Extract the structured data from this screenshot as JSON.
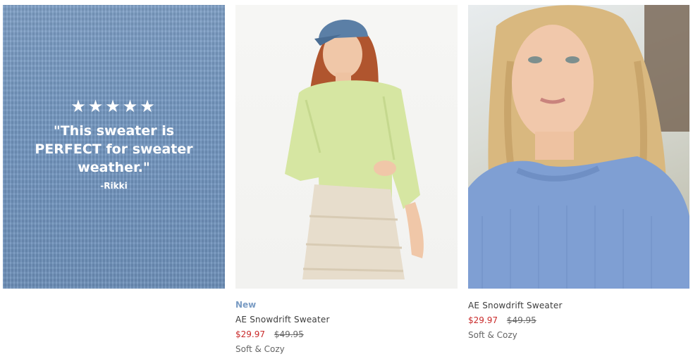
{
  "review": {
    "stars": "★★★★★",
    "quote": "\"This sweater is PERFECT for sweater weather.\"",
    "author": "-Rikki"
  },
  "products": [
    {
      "badge": "New",
      "name": "AE Snowdrift Sweater",
      "sale_price": "$29.97",
      "original_price": "$49.95",
      "tagline": "Soft & Cozy",
      "sweater_color": "#d6e6a2"
    },
    {
      "name": "AE Snowdrift Sweater",
      "sale_price": "$29.97",
      "original_price": "$49.95",
      "tagline": "Soft & Cozy",
      "sweater_color": "#7f9fd3"
    }
  ],
  "colors": {
    "review_background": "#7397c1",
    "badge": "#7a9cc4",
    "sale_price": "#c92a2a"
  }
}
